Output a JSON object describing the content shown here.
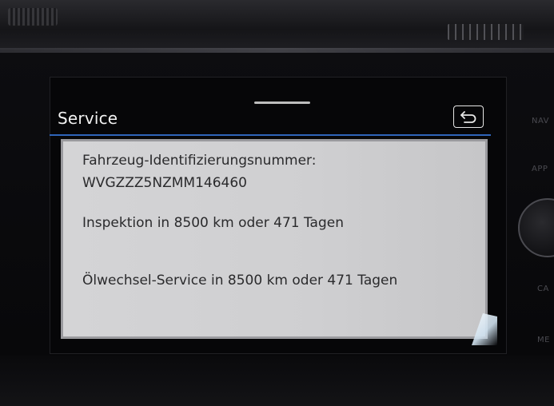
{
  "screen": {
    "title": "Service",
    "back_icon": "back-arrow-icon"
  },
  "info": {
    "vin_label": "Fahrzeug-Identifizierungsnummer:",
    "vin_value": "WVGZZZ5NZMM146460",
    "inspection": "Inspektion in 8500 km oder 471 Tagen",
    "oil_service": "Ölwechsel-Service in 8500 km oder 471 Tagen"
  },
  "side_buttons": {
    "nav": "NAV",
    "app": "APP",
    "car": "CA",
    "menu": "ME"
  },
  "colors": {
    "accent": "#2f64b9",
    "panel_bg": "#d4d4d6",
    "screen_bg": "#060608"
  }
}
